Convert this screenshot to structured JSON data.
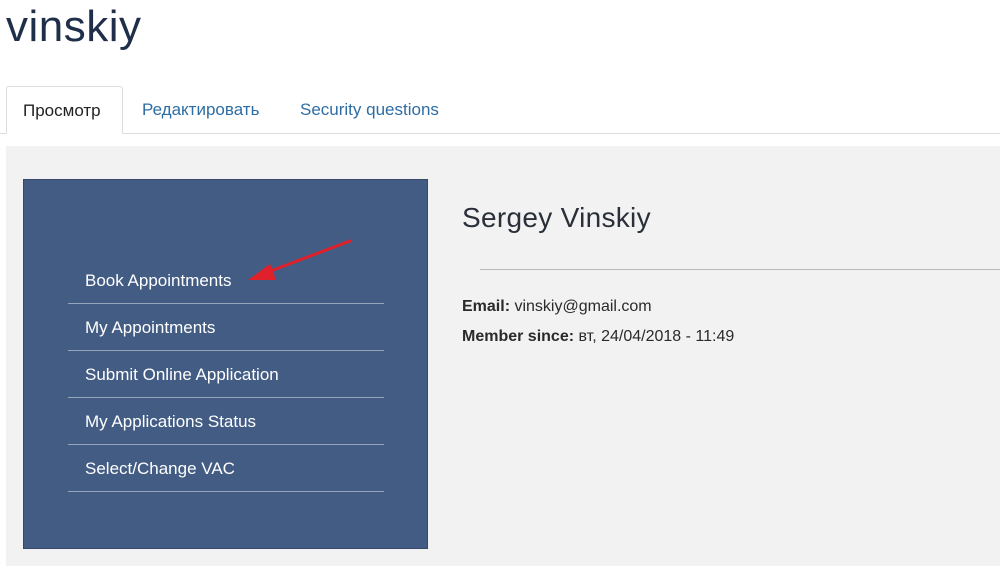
{
  "site": {
    "title": "vinskiy"
  },
  "tabs": [
    {
      "label": "Просмотр",
      "active": true
    },
    {
      "label": "Редактировать",
      "active": false
    },
    {
      "label": "Security questions",
      "active": false
    }
  ],
  "menu": {
    "items": [
      {
        "label": "Book Appointments"
      },
      {
        "label": "My Appointments"
      },
      {
        "label": "Submit Online Application"
      },
      {
        "label": "My Applications Status"
      },
      {
        "label": "Select/Change VAC"
      }
    ],
    "annotation_color": "#e0202a"
  },
  "profile": {
    "name": "Sergey Vinskiy",
    "email_label": "Email:",
    "email_value": " vinskiy@gmail.com",
    "member_label": "Member since:",
    "member_value": " вт, 24/04/2018 - 11:49"
  },
  "colors": {
    "panel": "#435c84",
    "link": "#2e6da4",
    "content_bg": "#f2f2f2"
  }
}
